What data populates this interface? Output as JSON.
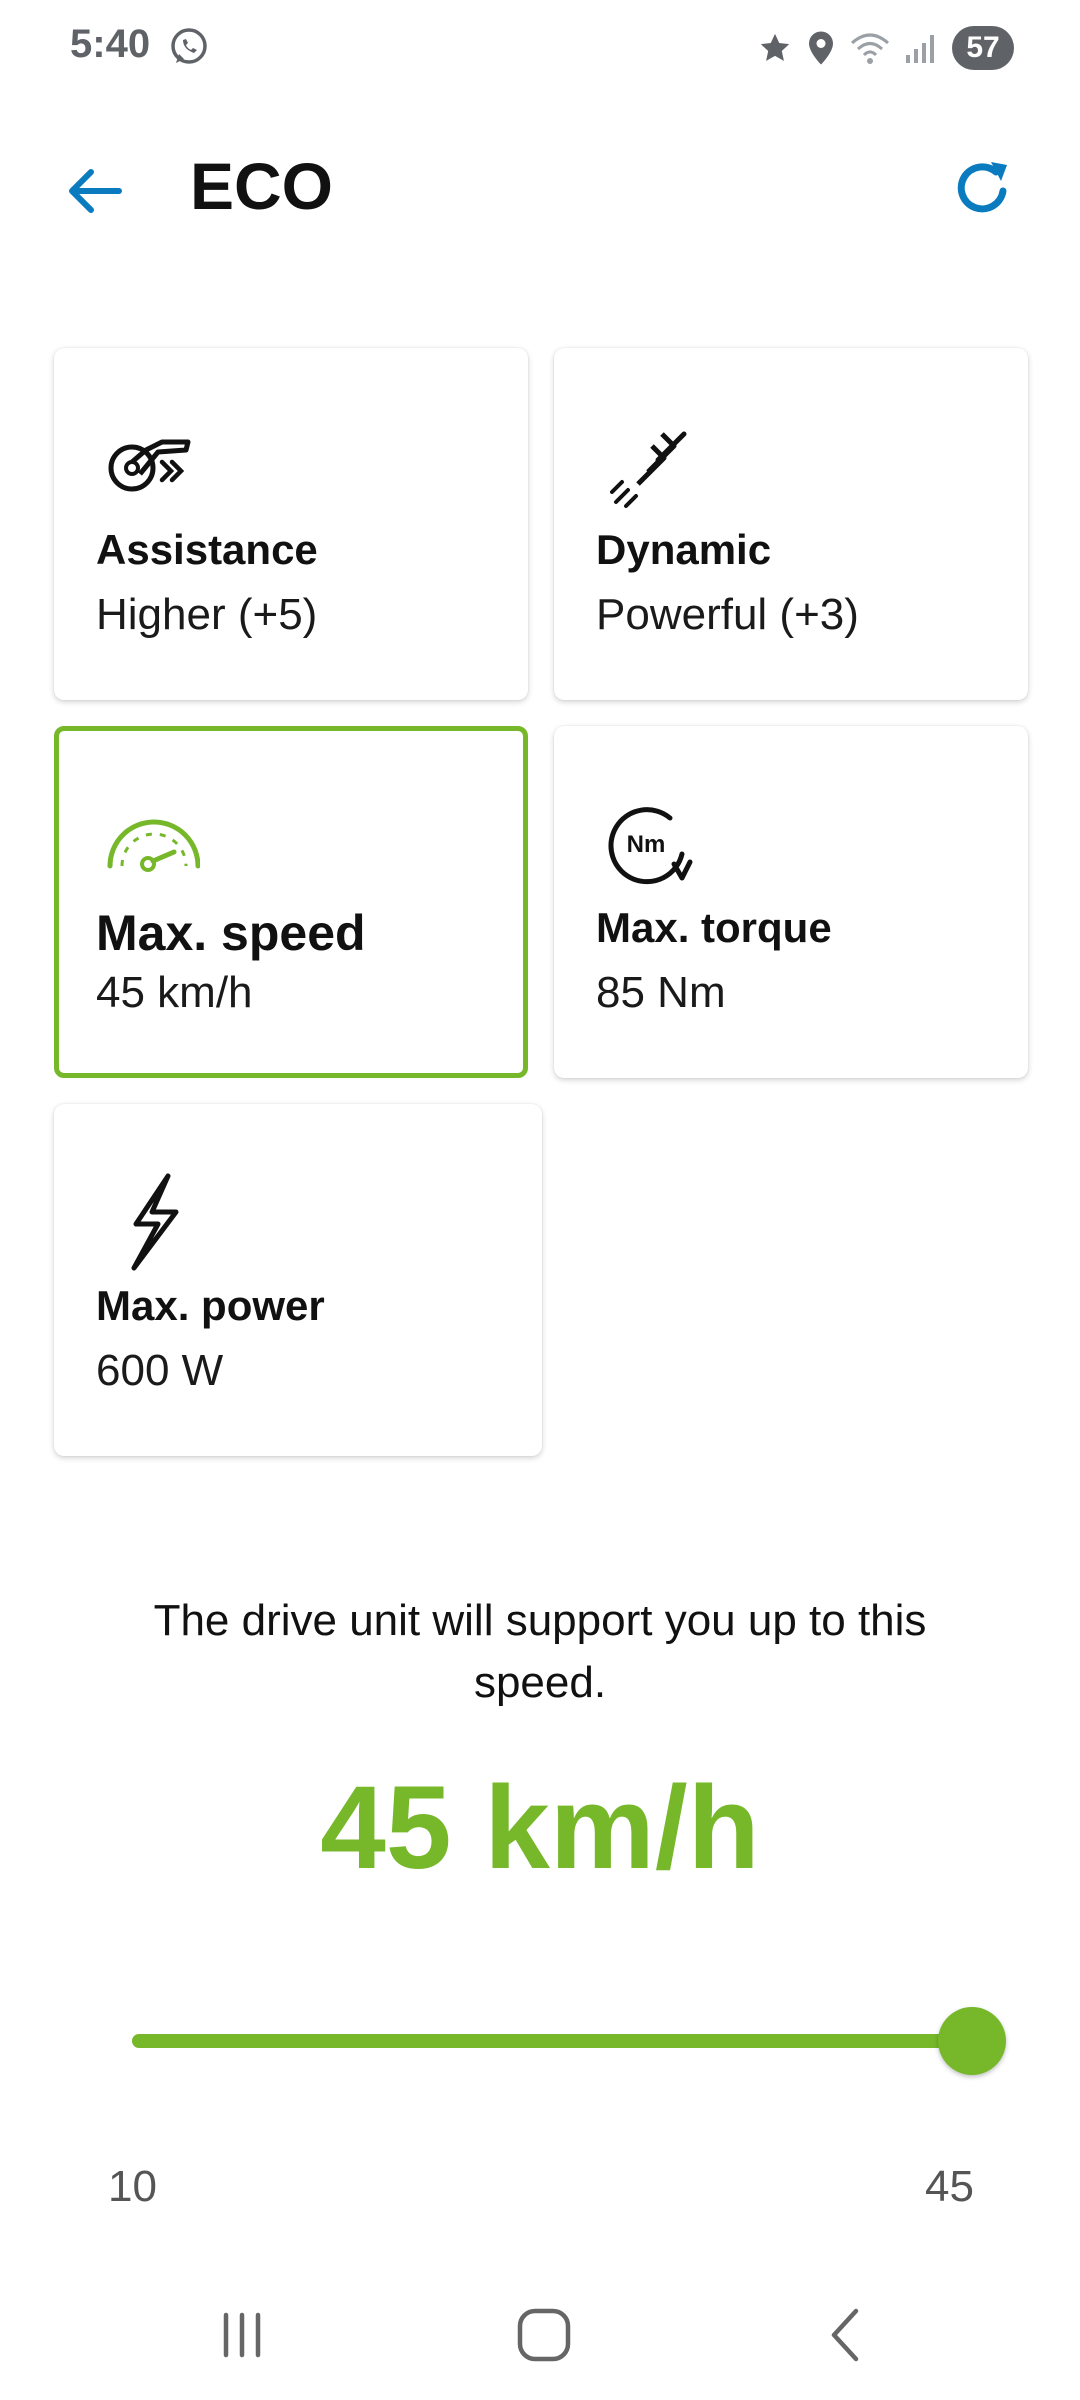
{
  "status_bar": {
    "time": "5:40",
    "battery": "57",
    "left_icons": [
      "whatsapp-icon"
    ],
    "right_icons": [
      "star-icon",
      "location-icon",
      "wifi-icon",
      "signal-icon",
      "battery-icon"
    ]
  },
  "header": {
    "title": "ECO",
    "back_icon": "arrow-back-icon",
    "refresh_icon": "refresh-icon"
  },
  "cards": [
    {
      "id": "assistance",
      "title": "Assistance",
      "value": "Higher (+5)",
      "icon": "assistance-icon",
      "selected": false
    },
    {
      "id": "dynamic",
      "title": "Dynamic",
      "value": "Powerful (+3)",
      "icon": "dynamic-icon",
      "selected": false
    },
    {
      "id": "speed",
      "title": "Max. speed",
      "value": "45 km/h",
      "icon": "speedometer-icon",
      "selected": true
    },
    {
      "id": "torque",
      "title": "Max. torque",
      "value": "85 Nm",
      "icon": "torque-icon",
      "selected": false
    },
    {
      "id": "power",
      "title": "Max. power",
      "value": "600 W",
      "icon": "lightning-icon",
      "selected": false
    }
  ],
  "detail": {
    "description": "The drive unit will support you up to this speed.",
    "value_label": "45 km/h",
    "slider": {
      "min": 10,
      "max": 45,
      "value": 45
    },
    "min_label": "10",
    "max_label": "45"
  },
  "colors": {
    "accent": "#76b82a",
    "link_blue": "#0a7bbf",
    "text": "#111111"
  },
  "nav_bar": {
    "icons": [
      "recents-icon",
      "home-icon",
      "back-icon"
    ]
  }
}
